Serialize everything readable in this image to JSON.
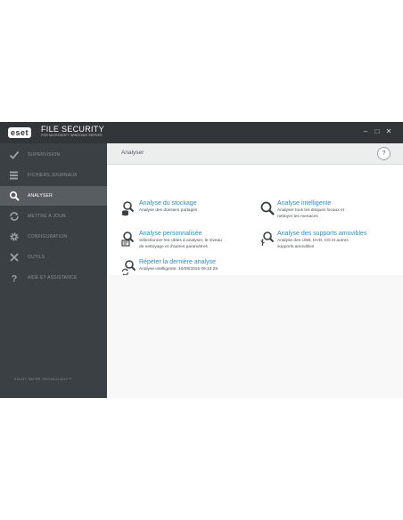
{
  "app": {
    "logo": "eset",
    "product_name": "FILE SECURITY",
    "product_sub": "FOR MICROSOFT WINDOWS SERVER",
    "controls": {
      "minimize": "–",
      "maximize": "□",
      "close": "✕"
    }
  },
  "sidebar": {
    "items": [
      {
        "label": "SUPERVISION",
        "icon": "checkmark-icon"
      },
      {
        "label": "FICHIERS JOURNAUX",
        "icon": "log-files-icon"
      },
      {
        "label": "ANALYSER",
        "icon": "search-icon",
        "active": true
      },
      {
        "label": "METTRE À JOUR",
        "icon": "refresh-icon"
      },
      {
        "label": "CONFIGURATION",
        "icon": "gear-icon"
      },
      {
        "label": "OUTILS",
        "icon": "tools-icon"
      },
      {
        "label": "AIDE ET ASSISTANCE",
        "icon": "question-icon"
      }
    ],
    "footer": "ENJOY SAFER TECHNOLOGY™"
  },
  "main": {
    "title": "Analyser",
    "help": "?",
    "actions": [
      {
        "title": "Analyse du stockage",
        "desc": [
          "Analyse des dossiers partagés"
        ],
        "icon": "storage-scan-icon"
      },
      {
        "title": "Analyse intelligente",
        "desc": [
          "Analyser tous les disques locaux et",
          "nettoyer les menaces"
        ],
        "icon": "smart-scan-icon"
      },
      {
        "title": "Analyse personnalisée",
        "desc": [
          "Sélectionner les cibles à analyser, le niveau",
          "de nettoyage et d'autres paramètres"
        ],
        "icon": "custom-scan-icon"
      },
      {
        "title": "Analyse des supports amovibles",
        "desc": [
          "Analyse des USB, DVD, CD et autres",
          "supports amovibles"
        ],
        "icon": "removable-media-scan-icon"
      },
      {
        "title": "Répéter la dernière analyse",
        "desc": [
          "Analyse intelligente: 10/09/2015 09:10:29"
        ],
        "icon": "repeat-scan-icon"
      }
    ]
  },
  "colors": {
    "titlebar": "#323639",
    "sidebar": "#3b4045",
    "sidebar_active": "#585d62",
    "link": "#2d8cc5"
  }
}
